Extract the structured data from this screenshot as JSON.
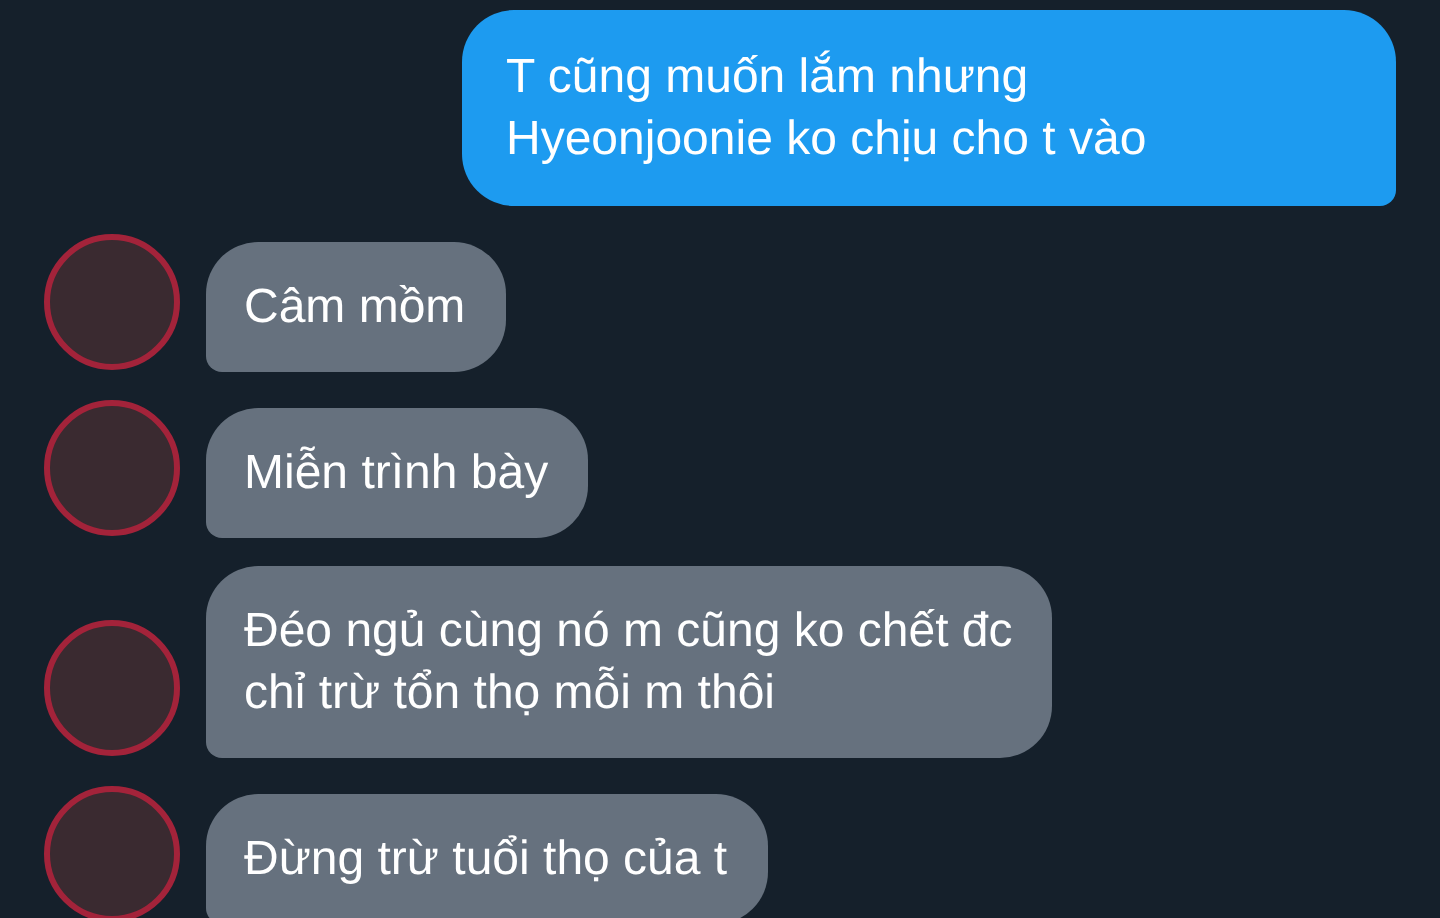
{
  "messages": [
    {
      "kind": "sent",
      "lines": [
        "T cũng muốn lắm nhưng",
        "Hyeonjoonie ko chịu cho t vào"
      ]
    },
    {
      "kind": "received",
      "lines": [
        "Câm mồm"
      ]
    },
    {
      "kind": "received",
      "lines": [
        "Miễn trình bày"
      ]
    },
    {
      "kind": "received",
      "lines": [
        "Đéo ngủ cùng nó m cũng ko chết đc",
        "chỉ trừ tổn thọ mỗi m thôi"
      ]
    },
    {
      "kind": "received",
      "lines": [
        "Đừng trừ tuổi thọ của t"
      ]
    }
  ]
}
